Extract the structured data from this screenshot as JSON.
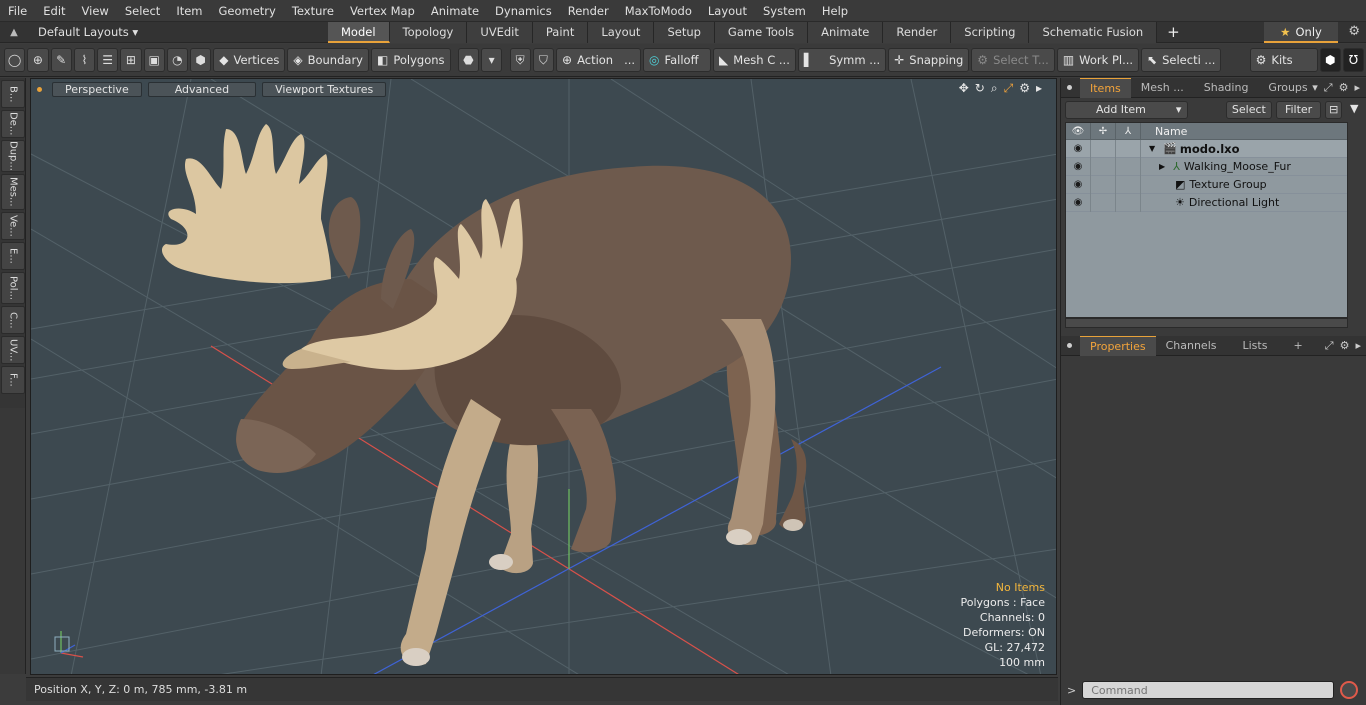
{
  "menu": [
    "File",
    "Edit",
    "View",
    "Select",
    "Item",
    "Geometry",
    "Texture",
    "Vertex Map",
    "Animate",
    "Dynamics",
    "Render",
    "MaxToModo",
    "Layout",
    "System",
    "Help"
  ],
  "layout": {
    "selector": "Default Layouts ▾",
    "tabs": [
      "Model",
      "Topology",
      "UVEdit",
      "Paint",
      "Layout",
      "Setup",
      "Game Tools",
      "Animate",
      "Render",
      "Scripting",
      "Schematic Fusion"
    ],
    "active_tab": "Model",
    "only_label": "Only"
  },
  "toolbar": {
    "vertices": "Vertices",
    "boundary": "Boundary",
    "polygons": "Polygons",
    "action": "Action",
    "action_more": "...",
    "falloff": "Falloff",
    "mesh": "Mesh C ...",
    "symm": "Symm ...",
    "snapping": "Snapping",
    "select_t": "Select T...",
    "work_pl": "Work Pl...",
    "selecti": "Selecti ...",
    "kits": "Kits"
  },
  "left_tools": [
    "B...",
    "De...",
    "Dup...",
    "Mes...",
    "Ve...",
    "E...",
    "Pol...",
    "C...",
    "UV...",
    "F..."
  ],
  "viewport": {
    "perspective": "Perspective",
    "advanced": "Advanced",
    "textures": "Viewport Textures",
    "info": {
      "title": "No Items",
      "polygons": "Polygons : Face",
      "channels": "Channels: 0",
      "deformers": "Deformers: ON",
      "gl": "GL: 27,472",
      "scale": "100 mm"
    },
    "colors": {
      "background": "#3d4950",
      "x_axis": "#d8514a",
      "z_axis": "#3f63d6",
      "y_axis": "#6fc060"
    }
  },
  "status": {
    "position": "Position X, Y, Z:   0 m, 785 mm, -3.81 m"
  },
  "items_panel": {
    "tabs": [
      "Items",
      "Mesh ...",
      "Shading",
      "Groups"
    ],
    "active": "Items",
    "add_item": "Add Item",
    "select": "Select",
    "filter": "Filter",
    "col_name": "Name",
    "rows": [
      {
        "name": "modo.lxo",
        "icon": "scene-icon"
      },
      {
        "name": "Walking_Moose_Fur",
        "icon": "mesh-icon"
      },
      {
        "name": "Texture Group",
        "icon": "texture-group-icon"
      },
      {
        "name": "Directional Light",
        "icon": "light-icon"
      }
    ]
  },
  "props_panel": {
    "tabs": [
      "Properties",
      "Channels",
      "Lists"
    ],
    "active": "Properties"
  },
  "command": {
    "placeholder": "Command"
  }
}
